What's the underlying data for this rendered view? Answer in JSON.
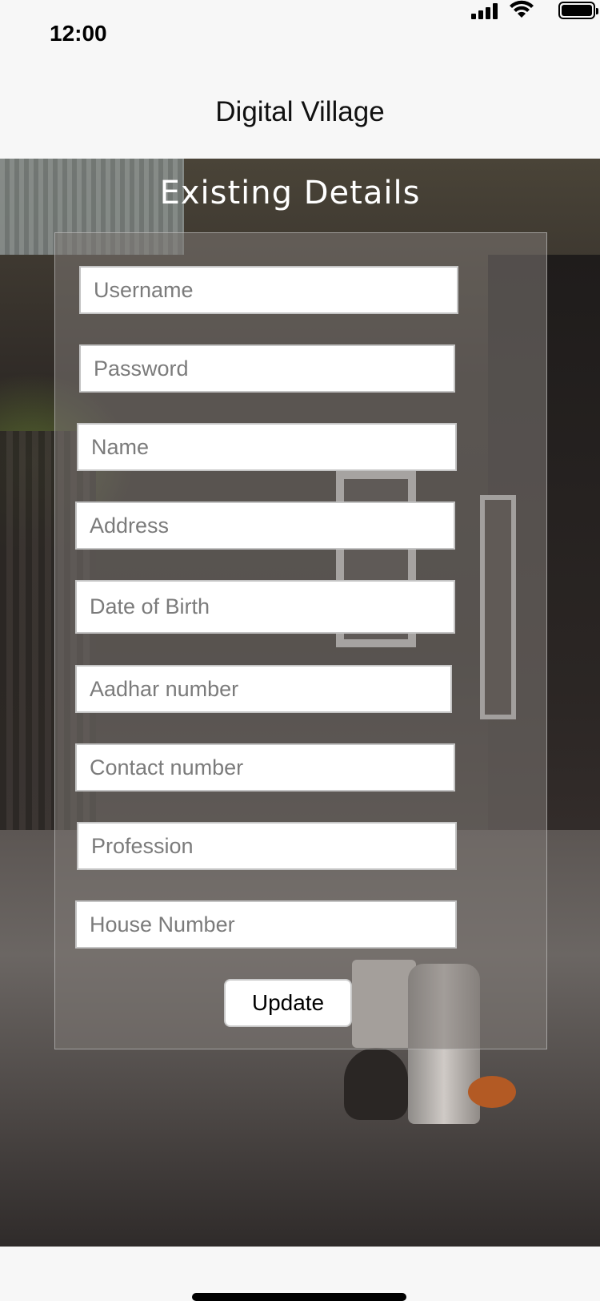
{
  "status_bar": {
    "time": "12:00",
    "icons": [
      "signal-icon",
      "wifi-icon",
      "battery-icon"
    ]
  },
  "nav": {
    "title": "Digital Village"
  },
  "page": {
    "heading": "Existing Details"
  },
  "form": {
    "fields": [
      {
        "name": "username",
        "placeholder": "Username"
      },
      {
        "name": "password",
        "placeholder": "Password"
      },
      {
        "name": "name",
        "placeholder": "Name"
      },
      {
        "name": "address",
        "placeholder": "Address"
      },
      {
        "name": "dob",
        "placeholder": "Date of Birth"
      },
      {
        "name": "aadhar",
        "placeholder": "Aadhar number"
      },
      {
        "name": "contact",
        "placeholder": "Contact number"
      },
      {
        "name": "profession",
        "placeholder": "Profession"
      },
      {
        "name": "house",
        "placeholder": "House Number"
      }
    ],
    "submit_label": "Update"
  },
  "colors": {
    "nav_background": "#f7f7f7",
    "panel_overlay": "#7d7875",
    "field_background": "#ffffff",
    "placeholder_text": "#7b7b7b"
  }
}
